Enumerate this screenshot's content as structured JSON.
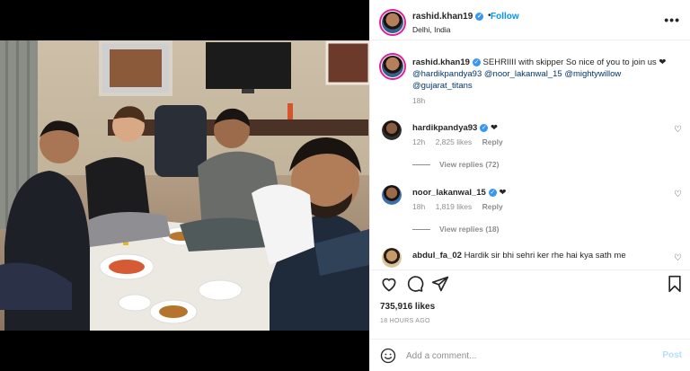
{
  "post": {
    "photo_alt": "Group selfie at a sehri meal",
    "header": {
      "username": "rashid.khan19",
      "verified_glyph": "✓",
      "separator": "•",
      "follow_label": "Follow",
      "location": "Delhi, India",
      "more_icon": "more-horizontal-icon",
      "more_glyph": "•••"
    },
    "caption": {
      "username": "rashid.khan19",
      "text": "SEHRIIII with skipper So nice of you to join us ❤",
      "mentions": [
        "@hardikpandya93",
        "@noor_lakanwal_15",
        "@mightywillow",
        "@gujarat_titans"
      ],
      "time": "18h"
    },
    "comments": [
      {
        "username": "hardikpandya93",
        "text": "❤",
        "time": "12h",
        "likes": "2,825 likes",
        "reply_label": "Reply",
        "view_replies": "View replies (72)"
      },
      {
        "username": "noor_lakanwal_15",
        "text": "❤",
        "time": "18h",
        "likes": "1,819 likes",
        "reply_label": "Reply",
        "view_replies": "View replies (18)"
      },
      {
        "username": "abdul_fa_02",
        "text": "Hardik sir bhi sehri ker rhe hai kya sath me"
      }
    ],
    "heart_glyph": "♡",
    "likes": "735,916 likes",
    "time_ago": "18 HOURS AGO",
    "comment_box": {
      "placeholder": "Add a comment...",
      "post_label": "Post"
    },
    "colors": {
      "accent": "#0095f6",
      "verified": "#3897f0",
      "post_disabled": "#b2dffc",
      "muted": "#8e8e8e"
    }
  }
}
